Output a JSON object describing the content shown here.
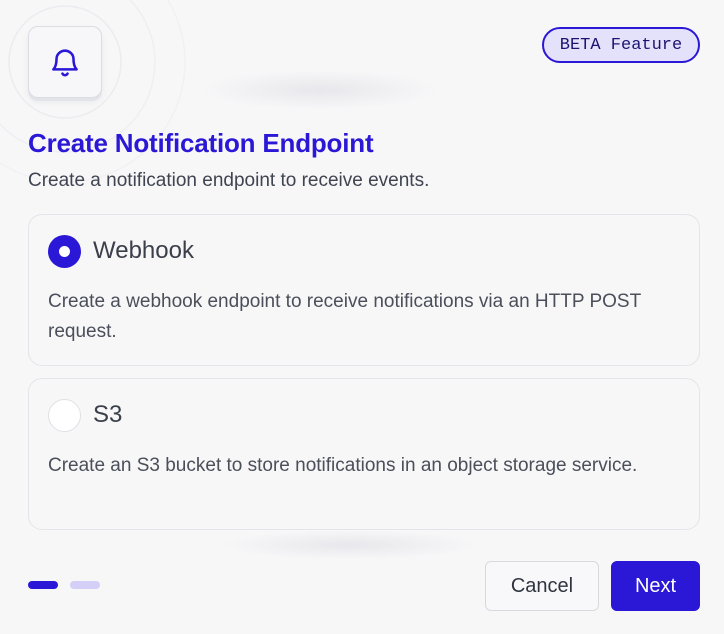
{
  "badge": {
    "label": "BETA Feature"
  },
  "header": {
    "icon": "bell-icon",
    "title": "Create Notification Endpoint",
    "subtitle": "Create a notification endpoint to receive events."
  },
  "options": [
    {
      "label": "Webhook",
      "description": "Create a webhook endpoint to receive notifications via an HTTP POST request.",
      "selected": true
    },
    {
      "label": "S3",
      "description": "Create an S3 bucket to store notifications in an object storage service.",
      "selected": false
    }
  ],
  "stepper": {
    "current_step": 1,
    "total_steps": 2
  },
  "footer": {
    "cancel_label": "Cancel",
    "next_label": "Next"
  },
  "colors": {
    "accent": "#2b17d6",
    "badge_bg": "#e4e1fb",
    "step_inactive": "#d3cff6"
  }
}
